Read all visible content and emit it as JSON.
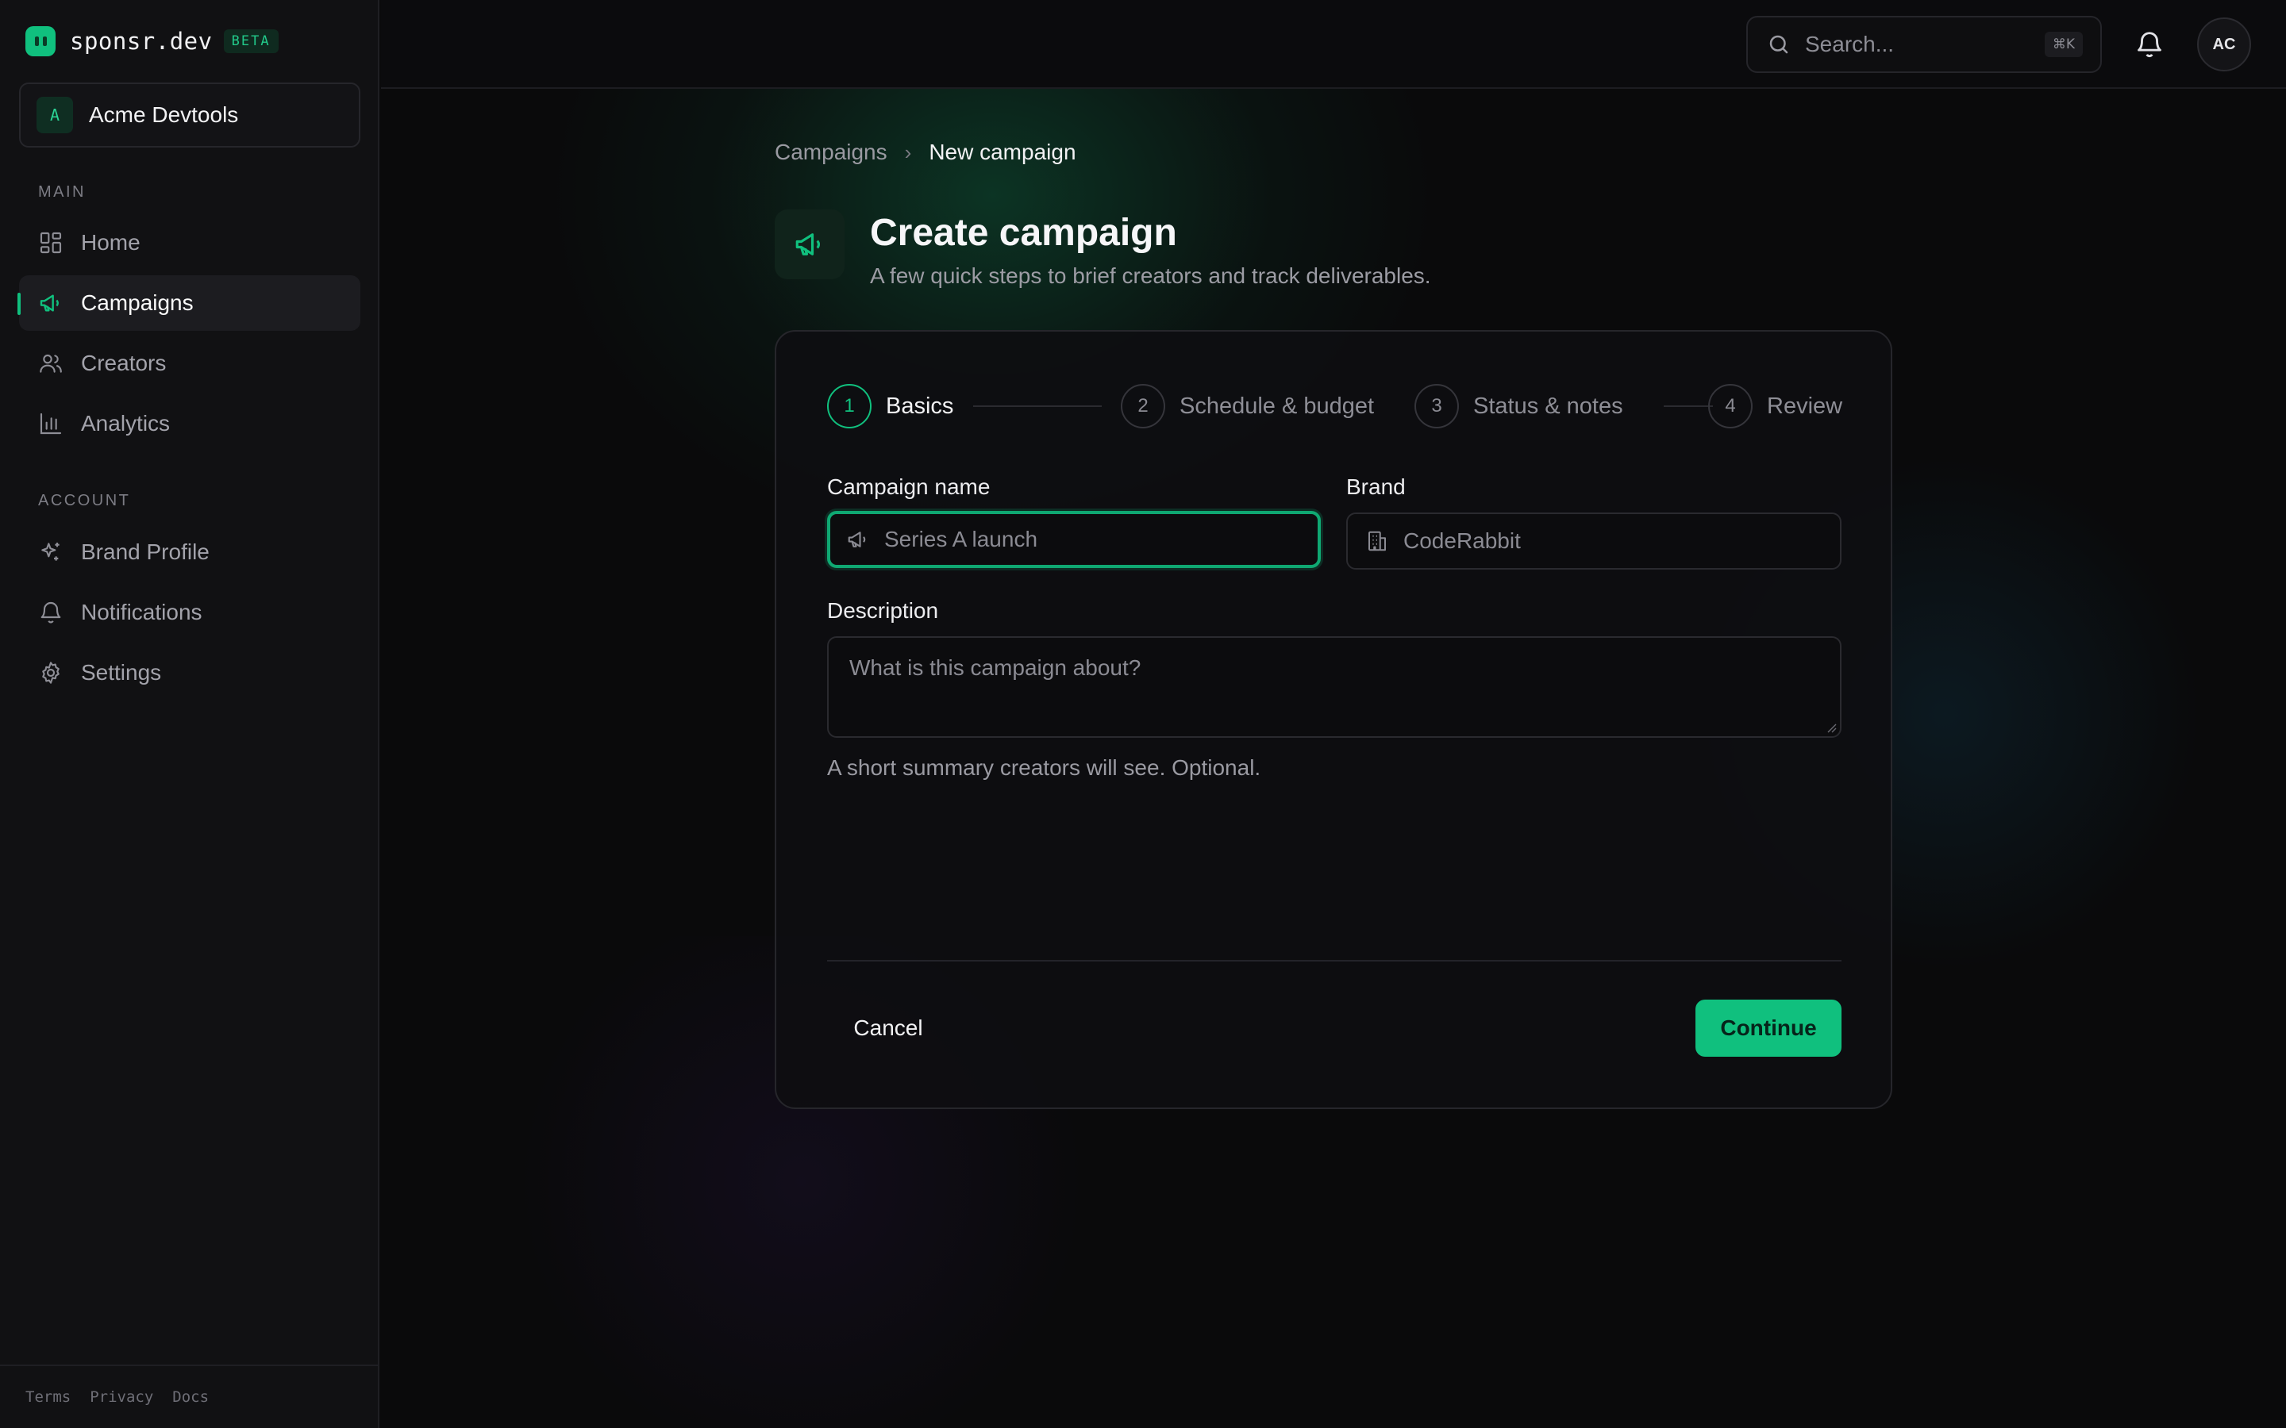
{
  "app": {
    "name": "sponsr.dev",
    "badge": "BETA",
    "accent_color": "#10c07e"
  },
  "workspace": {
    "initial": "A",
    "name": "Acme Devtools"
  },
  "sidebar": {
    "main_label": "MAIN",
    "account_label": "ACCOUNT",
    "main_items": [
      {
        "label": "Home",
        "icon": "grid-icon"
      },
      {
        "label": "Campaigns",
        "icon": "megaphone-icon",
        "active": true
      },
      {
        "label": "Creators",
        "icon": "users-icon"
      },
      {
        "label": "Analytics",
        "icon": "bar-chart-icon"
      }
    ],
    "account_items": [
      {
        "label": "Brand Profile",
        "icon": "sparkles-icon"
      },
      {
        "label": "Notifications",
        "icon": "bell-icon"
      },
      {
        "label": "Settings",
        "icon": "gear-icon"
      }
    ],
    "footer_links": [
      "Terms",
      "Privacy",
      "Docs"
    ]
  },
  "topbar": {
    "search_placeholder": "Search...",
    "search_shortcut": "⌘K",
    "avatar_initials": "AC"
  },
  "breadcrumb": {
    "parent": "Campaigns",
    "current": "New campaign"
  },
  "header": {
    "title": "Create campaign",
    "subtitle": "A few quick steps to brief creators and track deliverables."
  },
  "stepper": {
    "steps": [
      {
        "number": "1",
        "label": "Basics",
        "active": true
      },
      {
        "number": "2",
        "label": "Schedule & budget"
      },
      {
        "number": "3",
        "label": "Status & notes"
      },
      {
        "number": "4",
        "label": "Review"
      }
    ]
  },
  "form": {
    "campaign_name": {
      "label": "Campaign name",
      "placeholder": "Series A launch",
      "value": ""
    },
    "brand": {
      "label": "Brand",
      "placeholder": "CodeRabbit",
      "value": ""
    },
    "description": {
      "label": "Description",
      "placeholder": "What is this campaign about?",
      "helper": "A short summary creators will see. Optional."
    }
  },
  "actions": {
    "cancel": "Cancel",
    "continue": "Continue"
  }
}
